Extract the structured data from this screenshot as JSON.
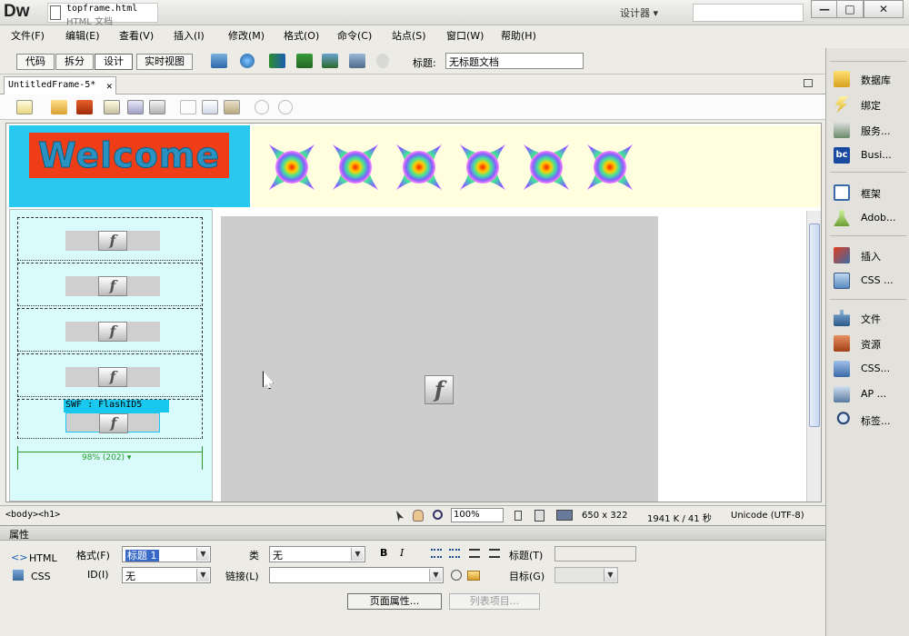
{
  "app": {
    "logo": "Dw",
    "doc_name": "topframe.html",
    "doc_type": "HTML 文档",
    "workspace": "设计器 ▾"
  },
  "window": {
    "minimize": "—",
    "maximize": "□",
    "close": "✕"
  },
  "menu": [
    "文件(F)",
    "编辑(E)",
    "查看(V)",
    "插入(I)",
    "修改(M)",
    "格式(O)",
    "命令(C)",
    "站点(S)",
    "窗口(W)",
    "帮助(H)"
  ],
  "viewbar": {
    "buttons": [
      "代码",
      "拆分",
      "设计",
      "实时视图"
    ],
    "active": "设计",
    "title_label": "标题:",
    "title_value": "无标题文档"
  },
  "doctab": {
    "label": "UntitledFrame-5*",
    "close": "✕"
  },
  "design": {
    "welcome_text": "Welcome",
    "swf_label": "SWF : FlashID5",
    "flash_glyph": "f",
    "width_indicator": "98% (202) ▾"
  },
  "statusbar": {
    "tag_selector": "<body><h1>",
    "zoom": "100%",
    "dimensions": "650 x 322",
    "size": "1941 K / 41 秒",
    "encoding": "Unicode (UTF-8)"
  },
  "properties": {
    "title": "属性",
    "html_tab": "HTML",
    "css_tab": "CSS",
    "format_label": "格式(F)",
    "format_value": "标题 1",
    "id_label": "ID(I)",
    "id_value": "无",
    "class_label": "类",
    "class_value": "无",
    "link_label": "链接(L)",
    "link_value": "",
    "heading_label": "标题(T)",
    "target_label": "目标(G)",
    "bold": "B",
    "italic": "I",
    "page_props_button": "页面属性...",
    "list_item_button": "列表项目..."
  },
  "right_panel": {
    "group1": [
      "数据库",
      "绑定",
      "服务...",
      "Busi..."
    ],
    "group2": [
      "框架",
      "Adob..."
    ],
    "group3": [
      "插入",
      "CSS ..."
    ],
    "group4": [
      "文件",
      "资源",
      "CSS...",
      "AP ...",
      "标签..."
    ]
  },
  "colors": {
    "accent": "#28c8ef",
    "welcome_bg": "#ef3e17",
    "banner_bg": "#ffffe0",
    "left_frame_bg": "#d9fbfb",
    "main_frame_bg": "#cdcdcd"
  }
}
